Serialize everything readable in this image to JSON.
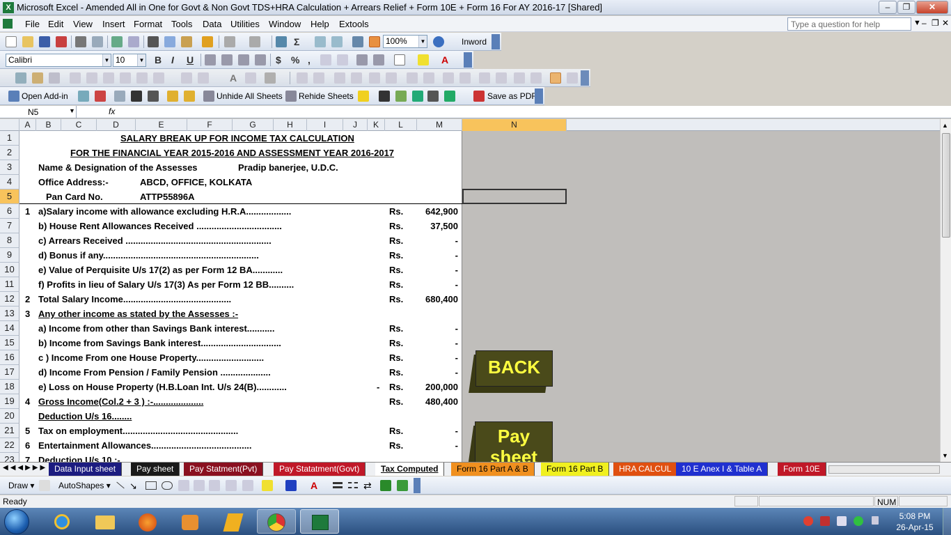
{
  "window": {
    "title": "Microsoft Excel - Amended All in One for Govt & Non Govt TDS+HRA Calculation + Arrears Relief + Form 10E + Form 16 For AY 2016-17  [Shared]"
  },
  "menu": {
    "items": [
      "File",
      "Edit",
      "View",
      "Insert",
      "Format",
      "Tools",
      "Data",
      "Utilities",
      "Window",
      "Help",
      "Extools"
    ],
    "help_placeholder": "Type a question for help"
  },
  "toolbar": {
    "zoom": "100%",
    "inword": "Inword",
    "font": "Calibri",
    "size": "10",
    "open_addin": "Open Add-in",
    "unhide": "Unhide All Sheets",
    "rehide": "Rehide Sheets",
    "save_pdf": "Save as PDF"
  },
  "formula": {
    "namebox": "N5",
    "fx": "fx",
    "content": ""
  },
  "columns": [
    "A",
    "B",
    "C",
    "D",
    "E",
    "F",
    "G",
    "H",
    "I",
    "J",
    "K",
    "L",
    "M",
    "N"
  ],
  "rows": [
    "1",
    "2",
    "3",
    "4",
    "5",
    "6",
    "7",
    "8",
    "9",
    "10",
    "11",
    "12",
    "13",
    "14",
    "15",
    "16",
    "17",
    "18",
    "19",
    "20",
    "21",
    "22",
    "23"
  ],
  "sheet": {
    "title1": "SALARY BREAK UP FOR INCOME TAX CALCULATION",
    "title2": "FOR THE FINANCIAL YEAR 2015-2016 AND ASSESSMENT YEAR 2016-2017",
    "name_label": "Name & Designation of the Assesses",
    "name_value": "Pradip banerjee, U.D.C.",
    "office_label": "Office Address:-",
    "office_value": "ABCD, OFFICE, KOLKATA",
    "pan_label": "Pan Card No.",
    "pan_value": "ATTP55896A",
    "lines": [
      {
        "num": "1",
        "text": "a)Salary income with allowance excluding H.R.A..................",
        "rs": "Rs.",
        "amt": "642,900"
      },
      {
        "num": "",
        "text": "b) House Rent Allowances Received ..................................",
        "rs": "Rs.",
        "amt": "37,500"
      },
      {
        "num": "",
        "text": "c) Arrears Received ..........................................................",
        "rs": "Rs.",
        "amt": "-"
      },
      {
        "num": "",
        "text": "d) Bonus if any..............................................................",
        "rs": "Rs.",
        "amt": "-"
      },
      {
        "num": "",
        "text": "e) Value of Perquisite U/s 17(2) as per Form 12 BA............",
        "rs": "Rs.",
        "amt": "-"
      },
      {
        "num": "",
        "text": "f) Profits in lieu of Salary U/s 17(3) As per Form 12 BB..........",
        "rs": "Rs.",
        "amt": "-"
      },
      {
        "num": "2",
        "text": "Total Salary Income...........................................",
        "rs": "Rs.",
        "amt": "680,400"
      },
      {
        "num": "3",
        "text": "Any other income as stated by the Assesses :-",
        "rs": "",
        "amt": ""
      },
      {
        "num": "",
        "text": "a) Income from other than Savings Bank interest...........",
        "rs": "Rs.",
        "amt": "-"
      },
      {
        "num": "",
        "text": "b) Income  from Savings Bank interest................................",
        "rs": "Rs.",
        "amt": "-"
      },
      {
        "num": "",
        "text": "c ) Income From one House Property...........................",
        "rs": "Rs.",
        "amt": "-"
      },
      {
        "num": "",
        "text": "d) Income From Pension / Family Pension ....................",
        "rs": "Rs.",
        "amt": "-"
      },
      {
        "num": "",
        "text": "e) Loss on House Property (H.B.Loan Int. U/s 24(B)............",
        "rs": "Rs.",
        "amt": "200,000",
        "minus": "-"
      },
      {
        "num": "4",
        "text": "Gross Income(Col.2 + 3 ) :-....................",
        "rs": "Rs.",
        "amt": "480,400"
      },
      {
        "num": "",
        "text": "Deduction U/s 16........",
        "rs": "",
        "amt": ""
      },
      {
        "num": "5",
        "text": "Tax on employment..............................................",
        "rs": "Rs.",
        "amt": "-"
      },
      {
        "num": "6",
        "text": "Entertainment Allowances........................................",
        "rs": "Rs.",
        "amt": "-"
      },
      {
        "num": "7",
        "text": "Deduction U/s 10 :-",
        "rs": "",
        "amt": ""
      }
    ]
  },
  "buttons": {
    "back": "BACK",
    "pay1": "Pay",
    "pay2": "sheet"
  },
  "tabs": [
    "Data Input sheet",
    "Pay sheet",
    "Pay Statment(Pvt)",
    "Pay Statatment(Govt)",
    "Tax Computed",
    "Form 16 Part A & B",
    "Form 16 Part B",
    "HRA CALCUL",
    "10 E Anex I & Table A",
    "Form 10E"
  ],
  "drawbar": {
    "draw": "Draw",
    "autoshapes": "AutoShapes"
  },
  "status": {
    "ready": "Ready",
    "num": "NUM"
  },
  "clock": {
    "time": "5:08 PM",
    "date": "26-Apr-15"
  }
}
